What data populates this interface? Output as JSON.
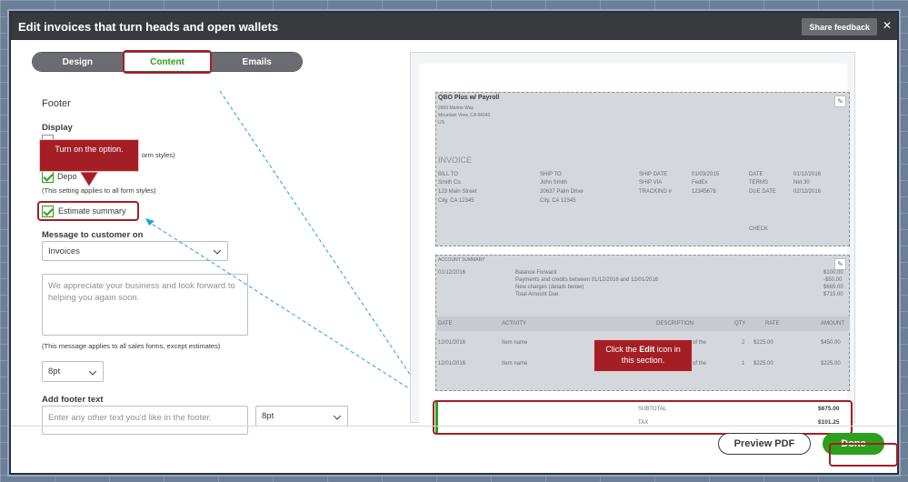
{
  "window": {
    "title": "Edit invoices that turn heads and open wallets",
    "share_feedback": "Share feedback",
    "close_glyph": "✕"
  },
  "tabs": [
    {
      "label": "Design",
      "active": false
    },
    {
      "label": "Content",
      "active": true
    },
    {
      "label": "Emails",
      "active": false
    }
  ],
  "left": {
    "section_title": "Footer",
    "display_label": "Display",
    "row1_partial": "orm styles)",
    "deposit_label": "Depo",
    "deposit_note": "(This setting applies to all form styles)",
    "estimate_summary_label": "Estimate summary",
    "message_label": "Message to customer on",
    "message_select": "Invoices",
    "message_text": "We appreciate your business and look forward to helping you again soon.",
    "message_note": "(This message applies to all sales forms, except estimates)",
    "font_size_1": "8pt",
    "footer_label": "Add footer text",
    "footer_placeholder": "Enter any other text you'd like in the footer.",
    "font_size_2": "8pt"
  },
  "callouts": {
    "turn_on": "Turn on the option.",
    "edit_pre": "Click the ",
    "edit_bold": "Edit",
    "edit_post": " icon in this section."
  },
  "preview": {
    "company": "QBO Plus w/ Payroll",
    "address1": "2600 Marine Way",
    "address2": "Mountain View, CA 94043",
    "address3": "US",
    "invoice_word": "INVOICE",
    "bill_to": "BILL TO",
    "bill_lines": [
      "Smith Co.",
      "123 Main Street",
      "City, CA 12345"
    ],
    "ship_to": "SHIP TO",
    "ship_lines": [
      "John Smith",
      "20637 Palm Drive",
      "City, CA 12345"
    ],
    "ship_date_label": "SHIP DATE",
    "ship_date": "01/03/2015",
    "ship_via_label": "SHIP VIA",
    "ship_via": "FedEx",
    "tracking_label": "TRACKING #",
    "tracking": "12345678",
    "date_label": "DATE",
    "date": "01/12/2016",
    "terms_label": "TERMS",
    "terms": "Net 30",
    "due_label": "DUE DATE",
    "due": "02/12/2016",
    "check_label": "CHECK",
    "account_summary": "ACCOUNT SUMMARY",
    "summary_date": "01/12/2016",
    "summary_lines": [
      {
        "label": "Balance Forward",
        "amount": "$100.00"
      },
      {
        "label": "Payments and credits between 01/12/2016 and 12/01/2016",
        "amount": "-$50.00"
      },
      {
        "label": "New charges (details below)",
        "amount": "$665.00"
      },
      {
        "label": "Total Amount Due",
        "amount": "$715.00"
      }
    ],
    "table_headers": [
      "DATE",
      "ACTIVITY",
      "DESCRIPTION",
      "QTY",
      "RATE",
      "AMOUNT"
    ],
    "rows": [
      {
        "date": "12/01/2016",
        "activity": "Item name",
        "desc": "of the",
        "qty": "2",
        "rate": "$225.00",
        "amount": "$450.00"
      },
      {
        "date": "12/01/2016",
        "activity": "Item name",
        "desc": "of the",
        "qty": "1",
        "rate": "$225.00",
        "amount": "$225.00"
      }
    ],
    "subtotal_label": "SUBTOTAL",
    "subtotal": "$675.00",
    "tax_label": "TAX",
    "tax": "$101.25"
  },
  "buttons": {
    "preview_pdf": "Preview PDF",
    "done": "Done"
  },
  "colors": {
    "accent_green": "#2ca01c",
    "callout_red": "#a41f25",
    "titlebar": "#393a3d",
    "arrow_blue": "#1ea0e6"
  }
}
